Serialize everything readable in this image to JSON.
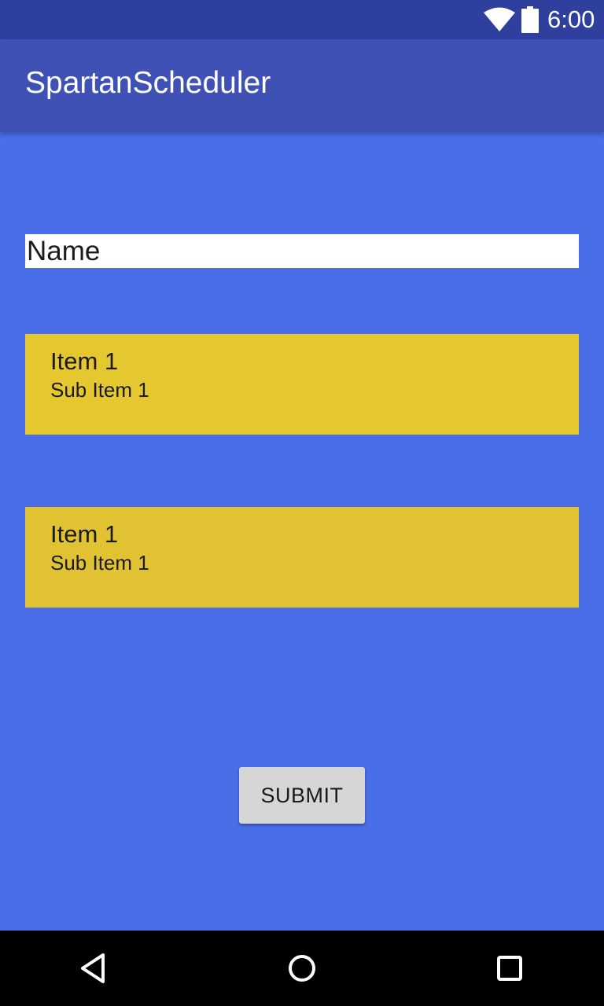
{
  "status_bar": {
    "time": "6:00",
    "icons": [
      "wifi-icon",
      "battery-icon"
    ]
  },
  "app_bar": {
    "title": "SpartanScheduler"
  },
  "form": {
    "name_field": {
      "value": "",
      "placeholder": "Name"
    },
    "items": [
      {
        "title": "Item 1",
        "subtitle": "Sub Item 1"
      },
      {
        "title": "Item 1",
        "subtitle": "Sub Item 1"
      }
    ],
    "submit_label": "SUBMIT"
  },
  "nav_bar": {
    "icons": [
      "back-icon",
      "home-icon",
      "recents-icon"
    ]
  },
  "colors": {
    "status_bar": "#2f3f9e",
    "app_bar": "#3f51b5",
    "background": "#4a6de8",
    "card": "#e5c830",
    "button": "#d6d6d6",
    "nav_bar": "#000000"
  }
}
